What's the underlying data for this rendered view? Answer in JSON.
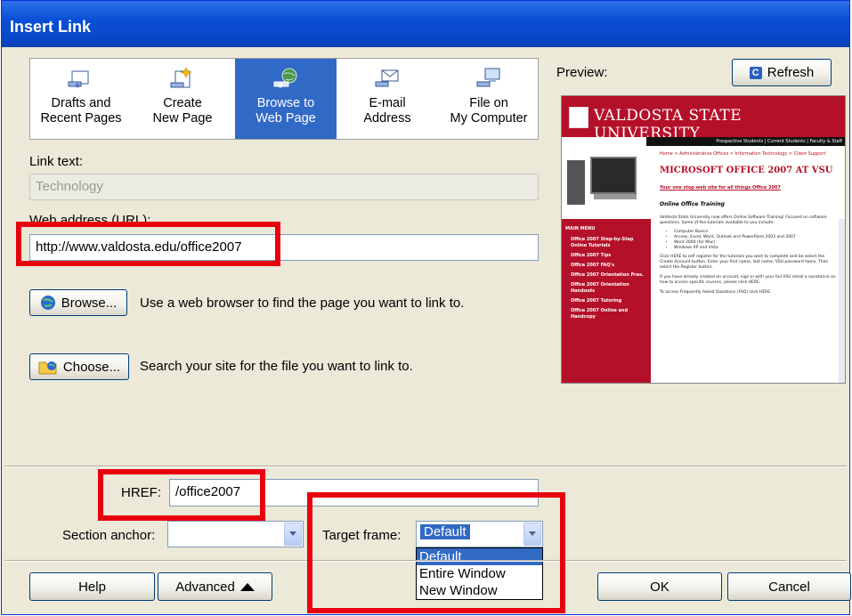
{
  "window": {
    "title": "Insert Link"
  },
  "tabs": [
    {
      "line1": "Drafts and",
      "line2": "Recent Pages",
      "icon": "drafts-icon",
      "selected": false
    },
    {
      "line1": "Create",
      "line2": "New Page",
      "icon": "new-page-icon",
      "selected": false
    },
    {
      "line1": "Browse to",
      "line2": "Web Page",
      "icon": "globe-link-icon",
      "selected": true
    },
    {
      "line1": "E-mail",
      "line2": "Address",
      "icon": "email-icon",
      "selected": false
    },
    {
      "line1": "File on",
      "line2": "My Computer",
      "icon": "computer-file-icon",
      "selected": false
    }
  ],
  "link_text": {
    "label": "Link text:",
    "value": "Technology"
  },
  "url": {
    "label": "Web address (URL):",
    "value": "http://www.valdosta.edu/office2007"
  },
  "browse": {
    "button": "Browse...",
    "description": "Use a web browser to find the page you want to link to."
  },
  "choose": {
    "button": "Choose...",
    "description": "Search your site for the file you want to link to."
  },
  "preview": {
    "label": "Preview:",
    "refresh_label": "Refresh",
    "site_title": "VALDOSTA STATE UNIVERSITY",
    "topnav": "Prospective Students | Current Students | Faculty & Staff",
    "breadcrumb": "Home > Administrative Offices > Information Technology > Client Support",
    "heading": "MICROSOFT OFFICE 2007 AT VSU",
    "tagline": "Your one stop web site for all things Office 2007",
    "subheading": "Online Office Training",
    "intro": "Valdosta State University now offers Online Software Training! Focused on software questions. Some of the tutorials available to you include:",
    "bullets": [
      "Computer Basics",
      "Access, Excel, Word, Outlook and PowerPoint 2003 and 2007",
      "Word 2004 (for Mac)",
      "Windows XP and Vista"
    ],
    "para2": "Click HERE to self register for the tutorials you wish to complete and be select the Create Account button. Enter your first name, last name, VSU password twice. Then select the Register button.",
    "para3": "If you have already created an account, sign in with your full VSU email a assistance on how to access specific courses, please click HERE.",
    "para4": "To access Frequently Asked Questions (FAQ) click HERE.",
    "menu_title": "MAIN MENU",
    "menu": [
      "Office 2007 Step-by-Step Online Tutorials",
      "Office 2007 Tips",
      "Office 2007 FAQ's",
      "Office 2007 Orientation Pres.",
      "Office 2007 Orientation Handouts",
      "Office 2007 Tutoring",
      "Office 2007 Online and Handcopy"
    ]
  },
  "href": {
    "label": "HREF:",
    "value": "/office2007"
  },
  "section_anchor": {
    "label": "Section anchor:",
    "value": ""
  },
  "target_frame": {
    "label": "Target frame:",
    "value": "Default",
    "options": [
      "Default",
      "Entire Window",
      "New Window"
    ]
  },
  "buttons": {
    "help": "Help",
    "advanced": "Advanced",
    "ok": "OK",
    "cancel": "Cancel"
  },
  "colors": {
    "highlight": "#e8000f",
    "selection": "#316ac5",
    "titlebar": "#0a4fd6",
    "dialog_bg": "#ece9d8"
  }
}
